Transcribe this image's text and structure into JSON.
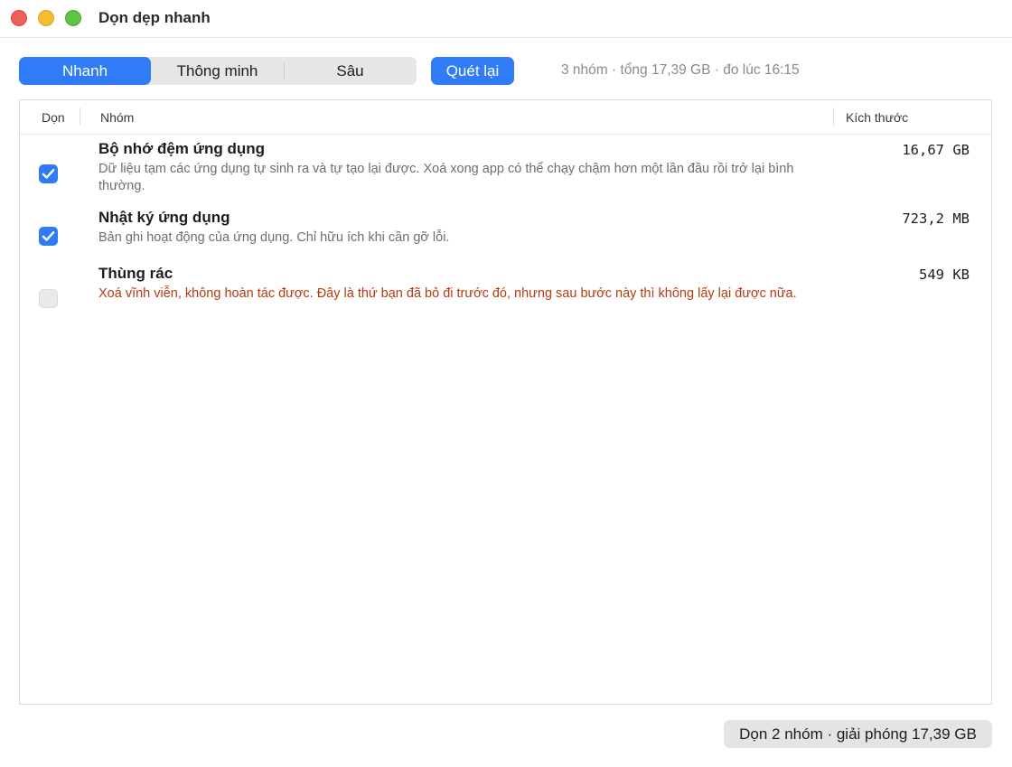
{
  "window": {
    "title": "Dọn dẹp nhanh"
  },
  "modes": {
    "items": [
      "Nhanh",
      "Thông minh",
      "Sâu"
    ],
    "selected": "Nhanh"
  },
  "toolbar": {
    "rescan_label": "Quét lại",
    "summary": "3 nhóm · tổng 17,39 GB · đo lúc 16:15"
  },
  "table": {
    "headers": {
      "clean": "Dọn",
      "group": "Nhóm",
      "size": "Kích thước"
    },
    "rows": [
      {
        "title": "Bộ nhớ đệm ứng dụng",
        "description": "Dữ liệu tạm các ứng dụng tự sinh ra và tự tạo lại được. Xoá xong app có thể chạy chậm hơn một lần đầu rồi trở lại bình thường.",
        "size": "16,67 GB",
        "checked": true
      },
      {
        "title": "Nhật ký ứng dụng",
        "description": "Bản ghi hoạt động của ứng dụng. Chỉ hữu ích khi cần gỡ lỗi.",
        "size": "723,2 MB",
        "checked": true
      },
      {
        "title": "Thùng rác",
        "description": "Xoá vĩnh viễn, không hoàn tác được. Đây là thứ bạn đã bỏ đi trước đó, nhưng sau bước này thì không lấy lại được nữa.",
        "size": "549 KB",
        "checked": false
      }
    ]
  },
  "footer": {
    "clean_button_label": "Dọn 2 nhóm · giải phóng 17,39 GB"
  },
  "colors": {
    "accent": "#2f7cf6",
    "warning": "#b8390c"
  }
}
